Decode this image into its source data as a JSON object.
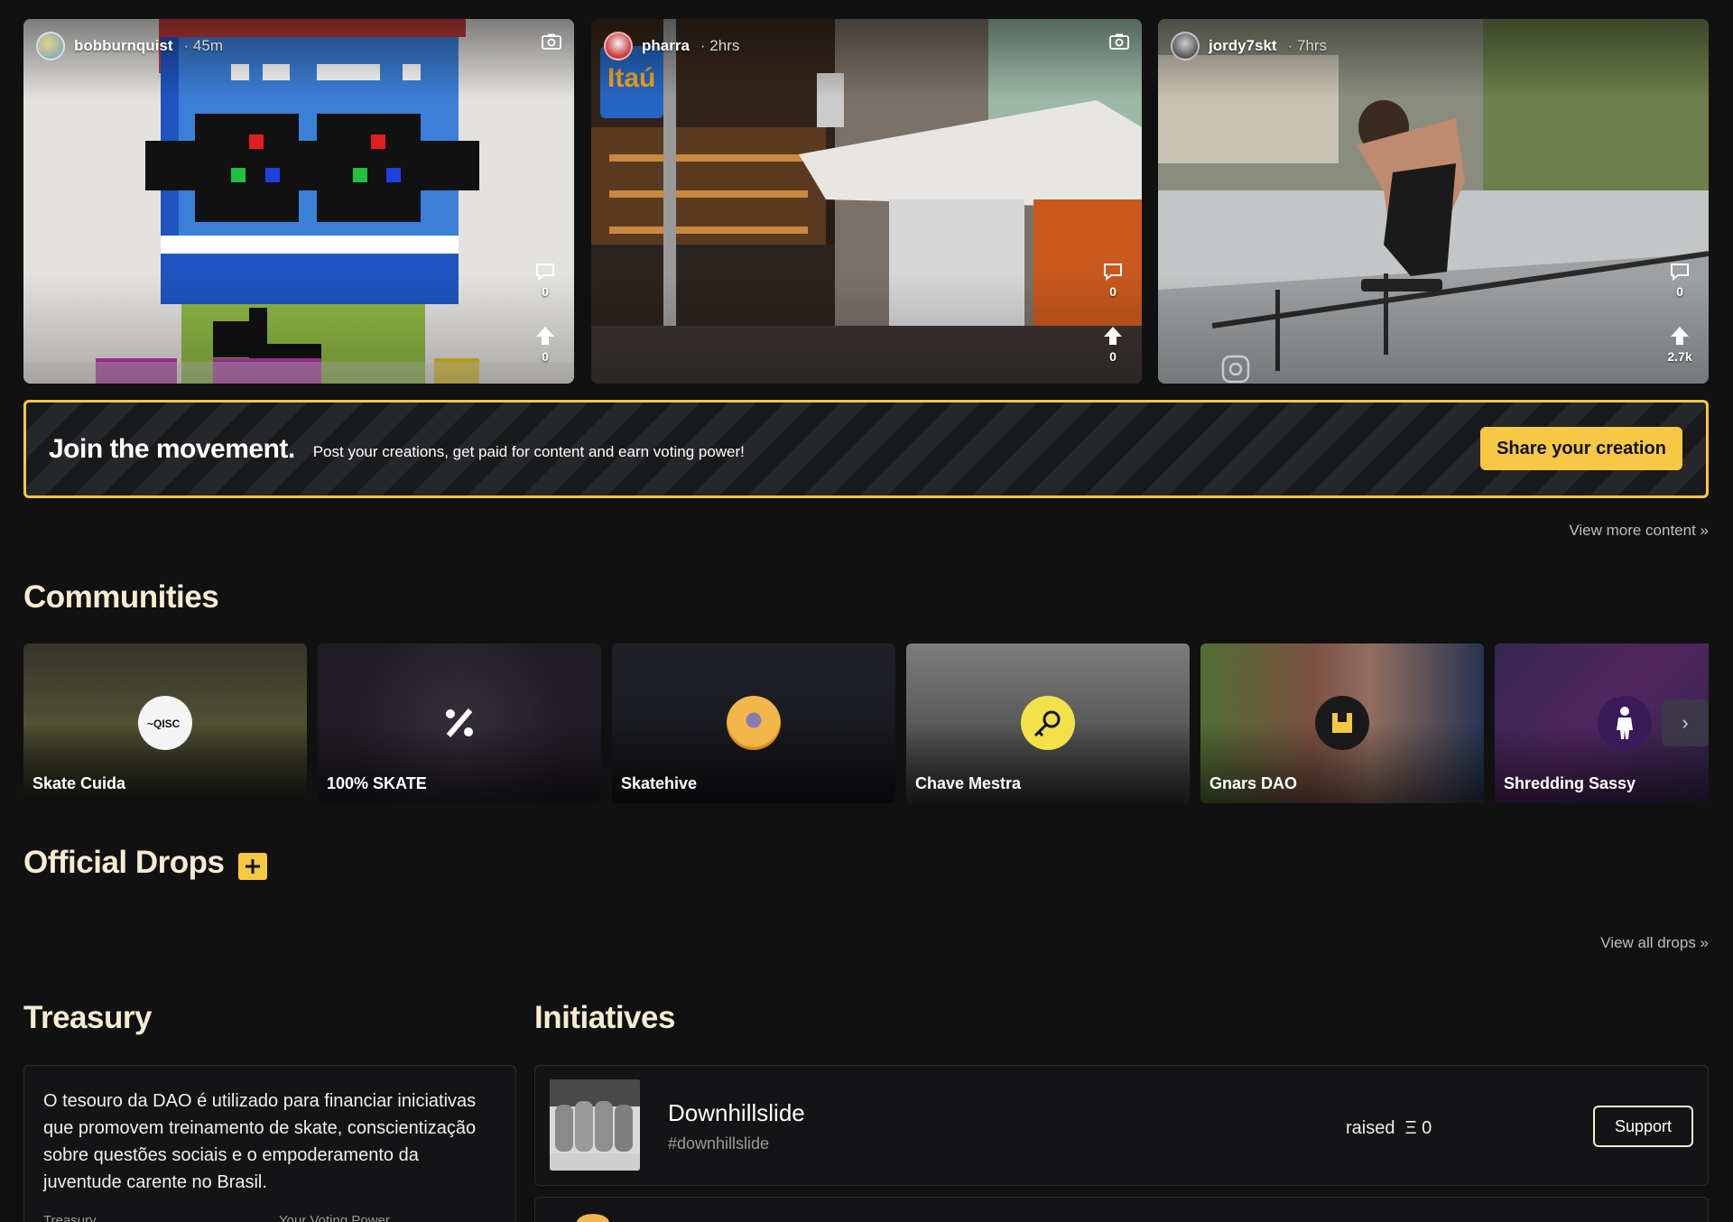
{
  "posts": [
    {
      "user": "bobburnquist",
      "time": "· 45m",
      "comments": "0",
      "votes": "0"
    },
    {
      "user": "pharra",
      "time": "· 2hrs",
      "comments": "0",
      "votes": "0"
    },
    {
      "user": "jordy7skt",
      "time": "· 7hrs",
      "comments": "0",
      "votes": "2.7k"
    }
  ],
  "join": {
    "title": "Join the movement.",
    "text": "Post your creations, get paid for content and earn voting power!",
    "button": "Share your creation"
  },
  "view_more_content": "View more content »",
  "communities": {
    "title": "Communities",
    "items": [
      {
        "name": "Skate Cuida"
      },
      {
        "name": "100% SKATE"
      },
      {
        "name": "Skatehive"
      },
      {
        "name": "Chave Mestra"
      },
      {
        "name": "Gnars DAO"
      },
      {
        "name": "Shredding Sassy"
      }
    ],
    "next": "›"
  },
  "drops": {
    "title": "Official Drops",
    "view_all": "View all drops »"
  },
  "treasury": {
    "title": "Treasury",
    "description": "O tesouro da DAO é utilizado para financiar iniciativas que promovem treinamento de skate, conscientização sobre questões sociais e o empoderamento da juventude carente no Brasil.",
    "label_treasury": "Treasury",
    "label_voting_power": "Your Voting Power"
  },
  "initiatives": {
    "title": "Initiatives",
    "items": [
      {
        "name": "Downhillslide",
        "tag": "#downhillslide",
        "raised": "raised  Ξ 0",
        "button": "Support"
      }
    ]
  },
  "colors": {
    "accent": "#f7c844",
    "background": "#111112",
    "heading": "#f7ecd0"
  }
}
